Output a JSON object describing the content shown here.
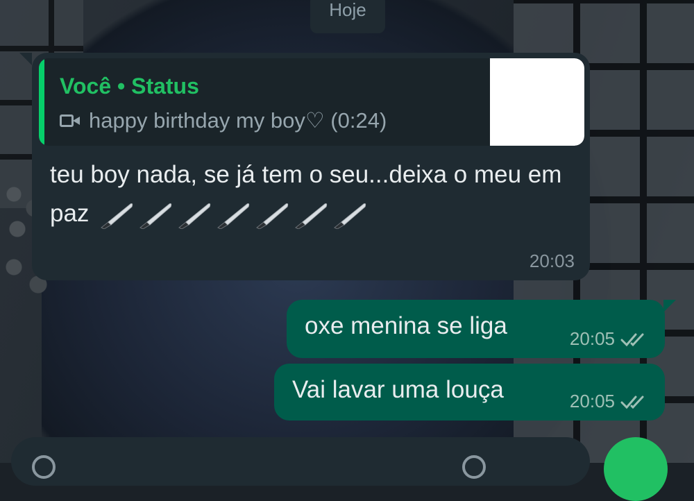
{
  "date_chip": {
    "label": "Hoje"
  },
  "incoming": {
    "reply_author": "Você • Status",
    "reply_caption": "happy birthday my boy♡ (0:24)",
    "text": "teu boy nada, se já tem o seu...deixa o meu em paz",
    "emoji_icons": [
      "knife-icon",
      "knife-icon",
      "knife-icon",
      "knife-icon",
      "knife-icon",
      "knife-icon",
      "knife-icon"
    ],
    "time": "20:03"
  },
  "outgoing": [
    {
      "text": "oxe menina se liga",
      "time": "20:05",
      "status": "read"
    },
    {
      "text": "Vai lavar uma louça",
      "time": "20:05",
      "status": "read"
    }
  ],
  "colors": {
    "accent_green": "#21c063",
    "outgoing_bubble": "#005c4b",
    "incoming_bubble": "#1f2b32"
  }
}
